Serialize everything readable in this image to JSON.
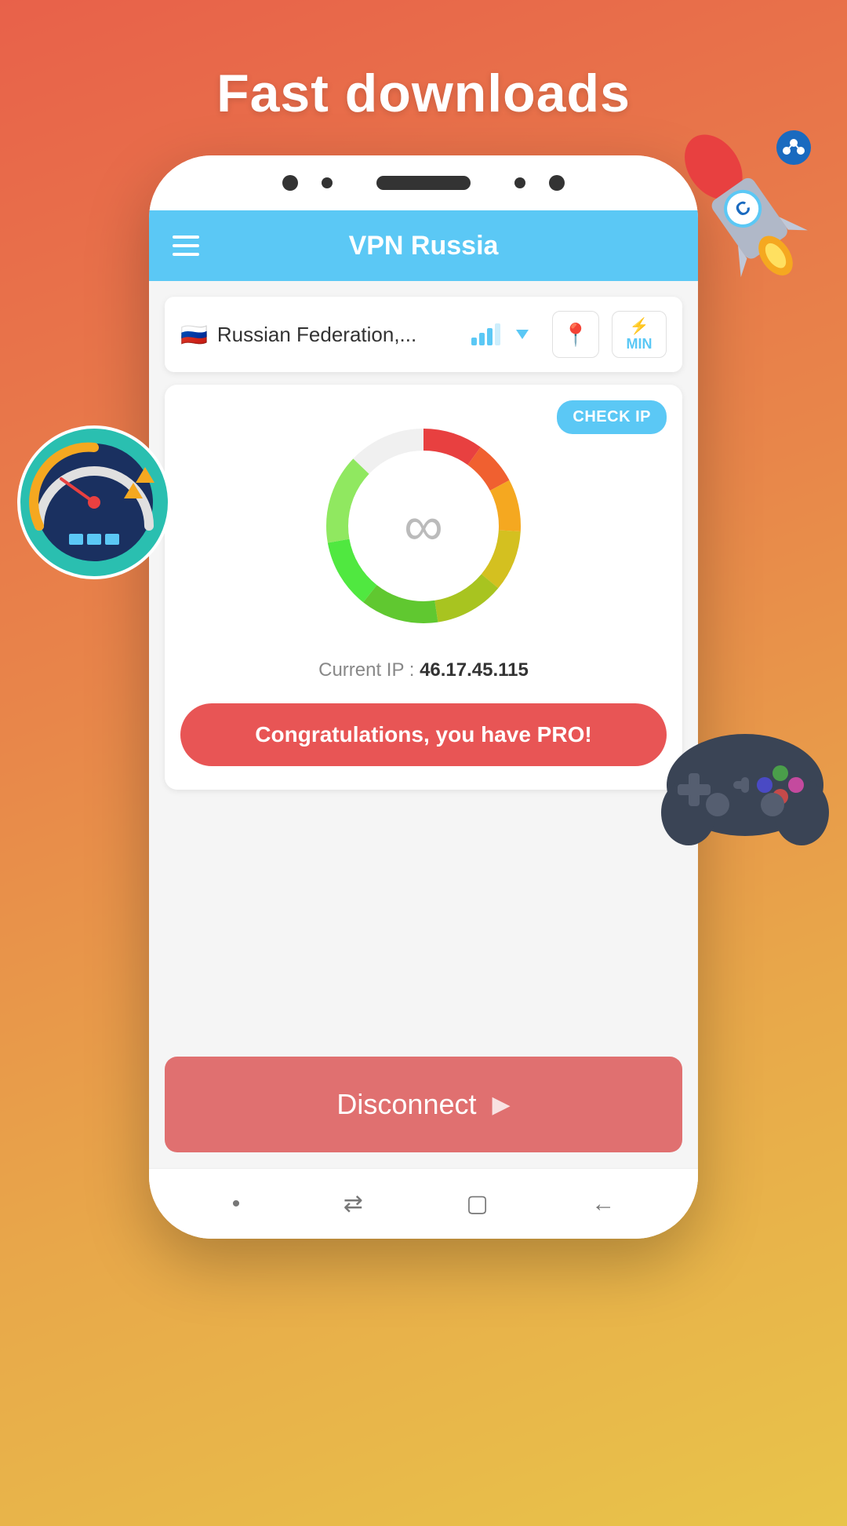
{
  "page": {
    "title": "Fast downloads",
    "background_gradient": "linear-gradient(160deg, #e8614a 0%, #e8864a 40%, #e8a84a 70%, #e8c44a 100%)"
  },
  "header": {
    "title": "VPN Russia",
    "menu_label": "Menu"
  },
  "server": {
    "country": "Russian Federation,...",
    "flag": "🇷🇺",
    "signal_strength": 3
  },
  "vpn": {
    "check_ip_label": "CHECK IP",
    "bandwidth_label": "∞",
    "current_ip_label": "Current IP :",
    "current_ip_value": "46.17.45.115",
    "pro_message": "Congratulations, you have PRO!"
  },
  "disconnect": {
    "label": "Disconnect",
    "arrow": "▶"
  },
  "nav": {
    "items": [
      "•",
      "⇄",
      "▢",
      "←"
    ]
  }
}
